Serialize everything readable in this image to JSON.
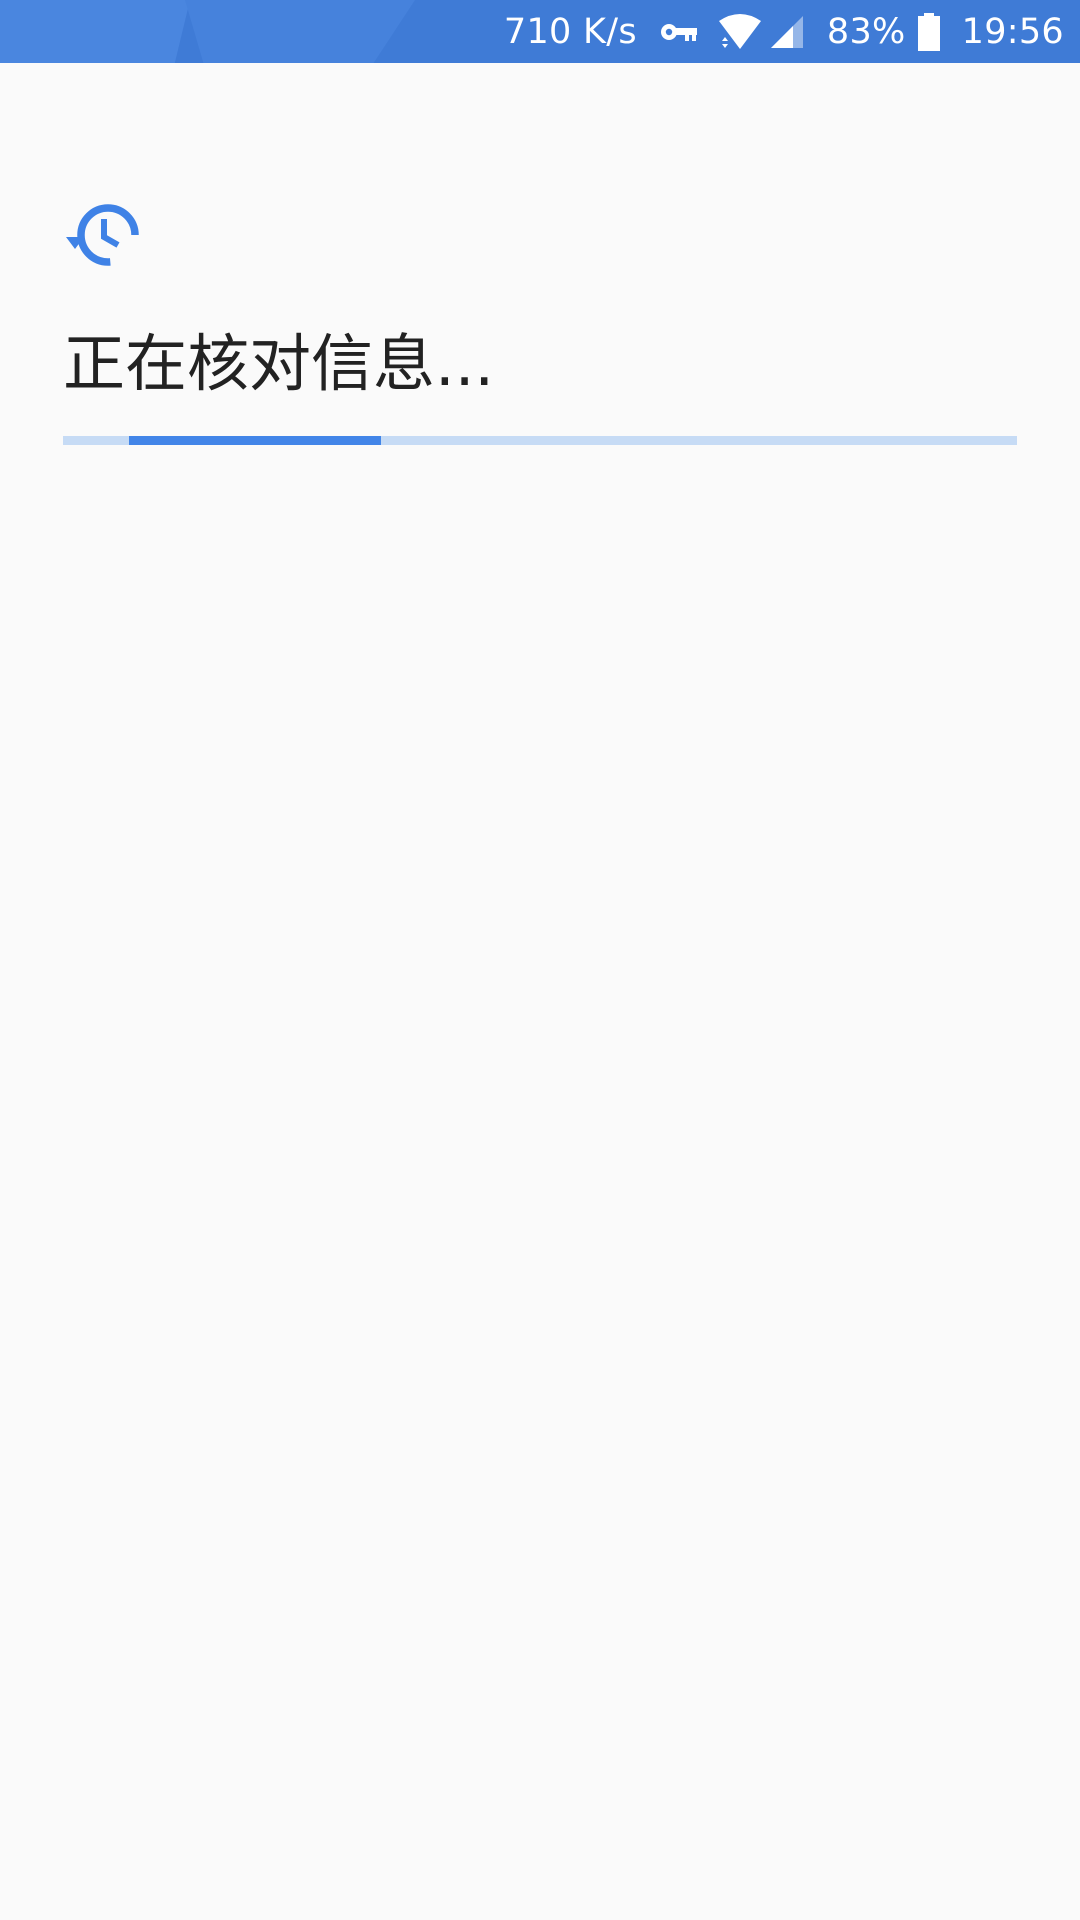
{
  "status_bar": {
    "network_speed": "710 K/s",
    "battery_percent": "83%",
    "time": "19:56",
    "icons": [
      "vpn-key-icon",
      "wifi-icon",
      "cell-signal-icon",
      "battery-icon"
    ],
    "background_color": "#3f7bd6"
  },
  "main": {
    "icon": "history-icon",
    "title": "正在核对信息...",
    "progress": {
      "indeterminate": true,
      "indicator_color": "#4285e8",
      "track_color": "#c6dbf5"
    }
  }
}
